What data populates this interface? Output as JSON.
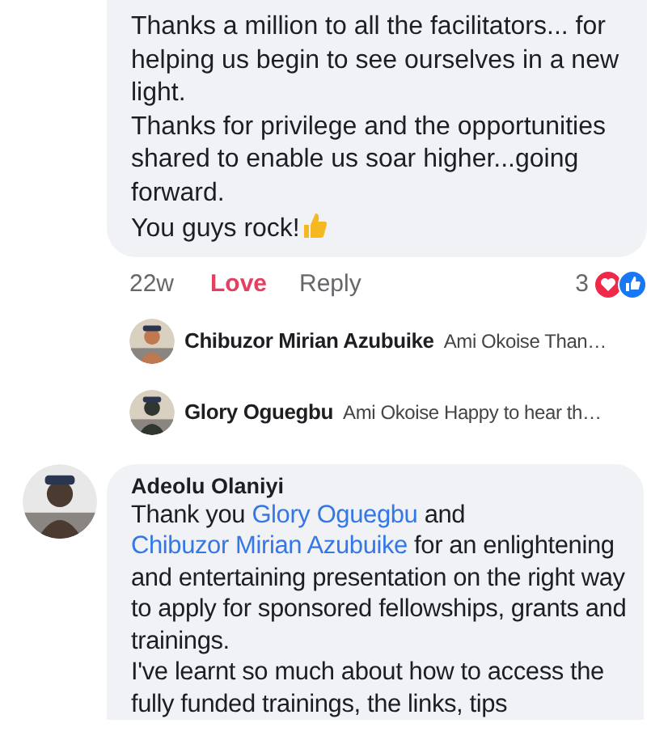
{
  "comment": {
    "paragraphs": [
      "Thanks a million to all the facilitators... for helping us begin to see ourselves in a new light.",
      "Thanks for privilege and the opportunities shared to enable us soar higher...going forward.",
      "You guys rock!"
    ],
    "time": "22w",
    "reaction_label": "Love",
    "reacted": true,
    "reply_label": "Reply",
    "reaction_count": "3",
    "replies": [
      {
        "author": "Chibuzor Mirian Azubuike",
        "preview": "Ami Okoise Than…",
        "color": "#c07850"
      },
      {
        "author": "Glory Oguegbu",
        "preview": "Ami Okoise Happy to hear th…",
        "color": "#303530"
      }
    ]
  },
  "next_comment": {
    "author": "Adeolu Olaniyi",
    "paragraphs": [
      [
        {
          "kind": "text",
          "text": "Thank you "
        },
        {
          "kind": "mention",
          "text": "Glory Oguegbu"
        },
        {
          "kind": "text",
          "text": " and "
        },
        {
          "kind": "mention",
          "text": "Chibuzor Mirian Azubuike"
        },
        {
          "kind": "text",
          "text": " for an enlightening and entertaining presentation on the right way to apply for sponsored fellowships, grants and trainings."
        }
      ],
      [
        {
          "kind": "text",
          "text": "I've learnt so much about how to access the fully funded trainings, the links, tips"
        }
      ]
    ]
  }
}
